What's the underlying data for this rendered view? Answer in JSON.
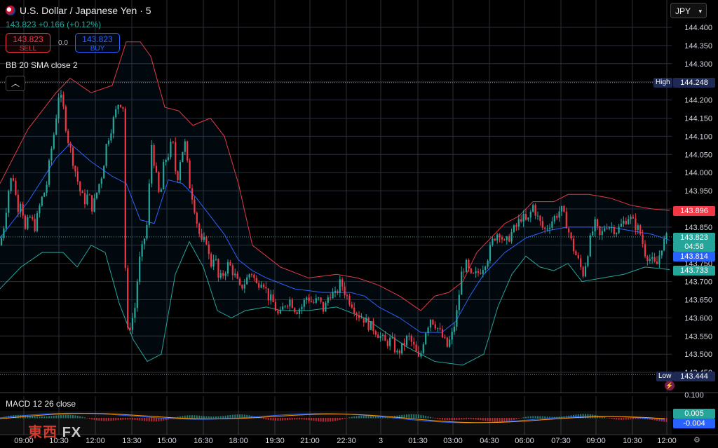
{
  "header": {
    "symbol": "U.S. Dollar / Japanese Yen · 5",
    "last_price_line": "143.823 +0.166 (+0.12%)"
  },
  "trade": {
    "sell_price": "143.823",
    "sell_label": "SELL",
    "spread": "0.0",
    "buy_price": "143.823",
    "buy_label": "BUY"
  },
  "indicators": {
    "bb_label": "BB 20 SMA close 2",
    "macd_label": "MACD 12 26 close"
  },
  "currency_selector": "JPY",
  "price_tags": {
    "high_label": "High",
    "high": "144.248",
    "upper_band": "143.896",
    "last": "143.823",
    "countdown": "04:58",
    "middle_band": "143.814",
    "lower_band": "143.733",
    "low_label": "Low",
    "low": "143.444",
    "macd_top": "0.100",
    "macd_value": "0.005",
    "signal_value": "-0.004"
  },
  "watermark": {
    "cn": "東西",
    "fx": "FX"
  },
  "colors": {
    "up": "#26a69a",
    "down": "#f23645",
    "bb_upper": "#e53946",
    "bb_basis": "#2962ff",
    "bb_lower": "#26a69a",
    "grid": "#2a2e39"
  },
  "chart_data": {
    "type": "candlestick",
    "title": "U.S. Dollar / Japanese Yen · 5",
    "y_ticks": [
      "144.400",
      "144.350",
      "144.300",
      "144.250",
      "144.200",
      "144.150",
      "144.100",
      "144.050",
      "144.000",
      "143.950",
      "143.900",
      "143.850",
      "143.800",
      "143.750",
      "143.700",
      "143.650",
      "143.600",
      "143.550",
      "143.500",
      "143.450"
    ],
    "x_ticks": [
      "09:00",
      "10:30",
      "12:00",
      "13:30",
      "15:00",
      "16:30",
      "18:00",
      "19:30",
      "21:00",
      "22:30",
      "3",
      "01:30",
      "03:00",
      "04:30",
      "06:00",
      "07:30",
      "09:00",
      "10:30",
      "12:00"
    ],
    "ylim": [
      143.43,
      144.42
    ],
    "high": 144.248,
    "low": 143.444,
    "last": 143.823,
    "close_path": [
      [
        0,
        143.8
      ],
      [
        6,
        143.86
      ],
      [
        12,
        143.95
      ],
      [
        18,
        144.0
      ],
      [
        25,
        143.9
      ],
      [
        30,
        143.93
      ],
      [
        36,
        143.84
      ],
      [
        42,
        143.88
      ],
      [
        50,
        143.85
      ],
      [
        58,
        143.92
      ],
      [
        66,
        143.96
      ],
      [
        72,
        144.05
      ],
      [
        78,
        144.12
      ],
      [
        84,
        144.22
      ],
      [
        90,
        144.18
      ],
      [
        96,
        144.1
      ],
      [
        102,
        144.05
      ],
      [
        108,
        144.0
      ],
      [
        114,
        143.95
      ],
      [
        120,
        143.92
      ],
      [
        126,
        143.94
      ],
      [
        132,
        143.9
      ],
      [
        140,
        143.96
      ],
      [
        146,
        144.0
      ],
      [
        152,
        144.08
      ],
      [
        158,
        144.12
      ],
      [
        164,
        144.16
      ],
      [
        170,
        144.2
      ],
      [
        176,
        144.18
      ],
      [
        180,
        143.55
      ],
      [
        186,
        143.58
      ],
      [
        192,
        143.62
      ],
      [
        198,
        143.75
      ],
      [
        204,
        143.8
      ],
      [
        210,
        143.86
      ],
      [
        216,
        144.08
      ],
      [
        222,
        144.0
      ],
      [
        228,
        143.92
      ],
      [
        234,
        144.03
      ],
      [
        240,
        144.05
      ],
      [
        246,
        144.09
      ],
      [
        252,
        143.97
      ],
      [
        258,
        144.05
      ],
      [
        264,
        144.08
      ],
      [
        270,
        143.97
      ],
      [
        276,
        143.92
      ],
      [
        282,
        143.85
      ],
      [
        288,
        143.8
      ],
      [
        294,
        143.82
      ],
      [
        300,
        143.74
      ],
      [
        306,
        143.78
      ],
      [
        312,
        143.7
      ],
      [
        318,
        143.72
      ],
      [
        326,
        143.75
      ],
      [
        334,
        143.72
      ],
      [
        342,
        143.68
      ],
      [
        350,
        143.7
      ],
      [
        358,
        143.73
      ],
      [
        366,
        143.69
      ],
      [
        374,
        143.71
      ],
      [
        382,
        143.66
      ],
      [
        390,
        143.64
      ],
      [
        398,
        143.6
      ],
      [
        406,
        143.64
      ],
      [
        414,
        143.65
      ],
      [
        422,
        143.62
      ],
      [
        430,
        143.63
      ],
      [
        438,
        143.66
      ],
      [
        446,
        143.64
      ],
      [
        454,
        143.65
      ],
      [
        462,
        143.62
      ],
      [
        470,
        143.67
      ],
      [
        478,
        143.66
      ],
      [
        486,
        143.7
      ],
      [
        494,
        143.66
      ],
      [
        502,
        143.64
      ],
      [
        510,
        143.61
      ],
      [
        518,
        143.6
      ],
      [
        526,
        143.58
      ],
      [
        534,
        143.57
      ],
      [
        542,
        143.55
      ],
      [
        550,
        143.53
      ],
      [
        558,
        143.54
      ],
      [
        566,
        143.5
      ],
      [
        574,
        143.52
      ],
      [
        582,
        143.55
      ],
      [
        590,
        143.52
      ],
      [
        598,
        143.48
      ],
      [
        606,
        143.56
      ],
      [
        614,
        143.6
      ],
      [
        622,
        143.58
      ],
      [
        630,
        143.55
      ],
      [
        638,
        143.52
      ],
      [
        646,
        143.56
      ],
      [
        652,
        143.62
      ],
      [
        658,
        143.72
      ],
      [
        664,
        143.75
      ],
      [
        672,
        143.71
      ],
      [
        680,
        143.72
      ],
      [
        688,
        143.74
      ],
      [
        696,
        143.77
      ],
      [
        704,
        143.82
      ],
      [
        712,
        143.84
      ],
      [
        720,
        143.8
      ],
      [
        728,
        143.83
      ],
      [
        736,
        143.85
      ],
      [
        744,
        143.88
      ],
      [
        752,
        143.86
      ],
      [
        760,
        143.91
      ],
      [
        768,
        143.87
      ],
      [
        776,
        143.84
      ],
      [
        784,
        143.86
      ],
      [
        792,
        143.88
      ],
      [
        800,
        143.9
      ],
      [
        808,
        143.86
      ],
      [
        816,
        143.8
      ],
      [
        824,
        143.76
      ],
      [
        832,
        143.72
      ],
      [
        840,
        143.8
      ],
      [
        848,
        143.86
      ],
      [
        856,
        143.82
      ],
      [
        864,
        143.86
      ],
      [
        872,
        143.85
      ],
      [
        880,
        143.84
      ],
      [
        888,
        143.86
      ],
      [
        896,
        143.88
      ],
      [
        904,
        143.86
      ],
      [
        912,
        143.84
      ],
      [
        920,
        143.78
      ],
      [
        928,
        143.76
      ],
      [
        936,
        143.74
      ],
      [
        944,
        143.8
      ],
      [
        952,
        143.823
      ]
    ],
    "bb_upper_path": [
      [
        0,
        143.97
      ],
      [
        40,
        144.12
      ],
      [
        80,
        144.22
      ],
      [
        100,
        144.26
      ],
      [
        130,
        144.22
      ],
      [
        160,
        144.24
      ],
      [
        180,
        144.36
      ],
      [
        200,
        144.36
      ],
      [
        215,
        144.32
      ],
      [
        235,
        144.18
      ],
      [
        255,
        144.17
      ],
      [
        275,
        144.13
      ],
      [
        300,
        144.15
      ],
      [
        320,
        144.1
      ],
      [
        340,
        143.97
      ],
      [
        360,
        143.8
      ],
      [
        380,
        143.77
      ],
      [
        400,
        143.74
      ],
      [
        440,
        143.71
      ],
      [
        480,
        143.72
      ],
      [
        510,
        143.71
      ],
      [
        540,
        143.69
      ],
      [
        570,
        143.66
      ],
      [
        600,
        143.62
      ],
      [
        620,
        143.66
      ],
      [
        640,
        143.67
      ],
      [
        660,
        143.7
      ],
      [
        680,
        143.78
      ],
      [
        700,
        143.82
      ],
      [
        720,
        143.86
      ],
      [
        740,
        143.88
      ],
      [
        760,
        143.92
      ],
      [
        790,
        143.92
      ],
      [
        810,
        143.94
      ],
      [
        840,
        143.94
      ],
      [
        870,
        143.93
      ],
      [
        900,
        143.91
      ],
      [
        930,
        143.9
      ],
      [
        955,
        143.896
      ]
    ],
    "bb_basis_path": [
      [
        0,
        143.82
      ],
      [
        40,
        143.92
      ],
      [
        80,
        144.04
      ],
      [
        100,
        144.08
      ],
      [
        130,
        144.03
      ],
      [
        160,
        143.99
      ],
      [
        180,
        143.97
      ],
      [
        200,
        143.87
      ],
      [
        220,
        143.86
      ],
      [
        240,
        143.98
      ],
      [
        260,
        143.97
      ],
      [
        280,
        143.93
      ],
      [
        300,
        143.88
      ],
      [
        320,
        143.83
      ],
      [
        340,
        143.76
      ],
      [
        360,
        143.73
      ],
      [
        380,
        143.71
      ],
      [
        420,
        143.68
      ],
      [
        460,
        143.67
      ],
      [
        500,
        143.67
      ],
      [
        520,
        143.66
      ],
      [
        540,
        143.63
      ],
      [
        570,
        143.6
      ],
      [
        600,
        143.56
      ],
      [
        630,
        143.56
      ],
      [
        650,
        143.59
      ],
      [
        670,
        143.66
      ],
      [
        690,
        143.72
      ],
      [
        720,
        143.78
      ],
      [
        750,
        143.82
      ],
      [
        780,
        143.84
      ],
      [
        810,
        143.85
      ],
      [
        840,
        143.85
      ],
      [
        870,
        143.85
      ],
      [
        900,
        143.84
      ],
      [
        930,
        143.83
      ],
      [
        955,
        143.814
      ]
    ],
    "bb_lower_path": [
      [
        0,
        143.68
      ],
      [
        30,
        143.74
      ],
      [
        60,
        143.78
      ],
      [
        90,
        143.78
      ],
      [
        110,
        143.74
      ],
      [
        130,
        143.8
      ],
      [
        150,
        143.78
      ],
      [
        170,
        143.64
      ],
      [
        190,
        143.54
      ],
      [
        210,
        143.48
      ],
      [
        230,
        143.5
      ],
      [
        250,
        143.72
      ],
      [
        270,
        143.81
      ],
      [
        290,
        143.74
      ],
      [
        310,
        143.62
      ],
      [
        330,
        143.6
      ],
      [
        350,
        143.62
      ],
      [
        380,
        143.63
      ],
      [
        400,
        143.62
      ],
      [
        440,
        143.62
      ],
      [
        480,
        143.63
      ],
      [
        520,
        143.6
      ],
      [
        550,
        143.56
      ],
      [
        580,
        143.52
      ],
      [
        620,
        143.48
      ],
      [
        660,
        143.47
      ],
      [
        690,
        143.5
      ],
      [
        710,
        143.63
      ],
      [
        730,
        143.72
      ],
      [
        750,
        143.77
      ],
      [
        770,
        143.74
      ],
      [
        790,
        143.73
      ],
      [
        810,
        143.75
      ],
      [
        830,
        143.7
      ],
      [
        860,
        143.71
      ],
      [
        890,
        143.72
      ],
      [
        920,
        143.74
      ],
      [
        955,
        143.733
      ]
    ]
  }
}
